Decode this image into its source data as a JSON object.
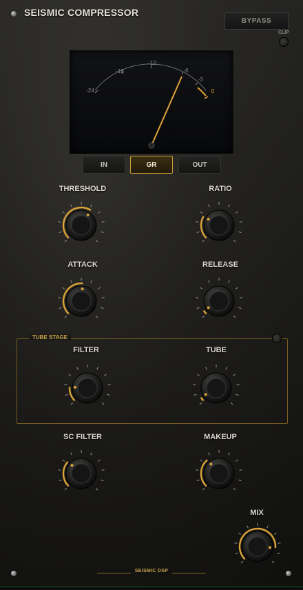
{
  "plugin": {
    "title": "SEISMIC COMPRESSOR",
    "bypass_label": "BYPASS",
    "clip_label": "CLIP",
    "footer": "SEISMIC DSP"
  },
  "meter": {
    "scale": [
      "-24",
      "-18",
      "-12",
      "-6",
      "-3",
      "0"
    ],
    "needle_value_db": -6,
    "accent": "#e5a53a"
  },
  "meter_modes": [
    {
      "label": "IN",
      "active": false
    },
    {
      "label": "GR",
      "active": true
    },
    {
      "label": "OUT",
      "active": false
    }
  ],
  "tube_stage_label": "TUBE STAGE",
  "knobs": {
    "threshold": {
      "label": "THRESHOLD",
      "value": 0.62
    },
    "ratio": {
      "label": "RATIO",
      "value": 0.28
    },
    "attack": {
      "label": "ATTACK",
      "value": 0.52
    },
    "release": {
      "label": "RELEASE",
      "value": 0.05
    },
    "filter": {
      "label": "FILTER",
      "value": 0.18
    },
    "tube": {
      "label": "TUBE",
      "value": 0.05
    },
    "sc_filter": {
      "label": "SC FILTER",
      "value": 0.32
    },
    "makeup": {
      "label": "MAKEUP",
      "value": 0.35
    },
    "mix": {
      "label": "MIX",
      "value": 0.85
    }
  },
  "colors": {
    "accent": "#d9a23a",
    "panel": "#1d1c19"
  }
}
